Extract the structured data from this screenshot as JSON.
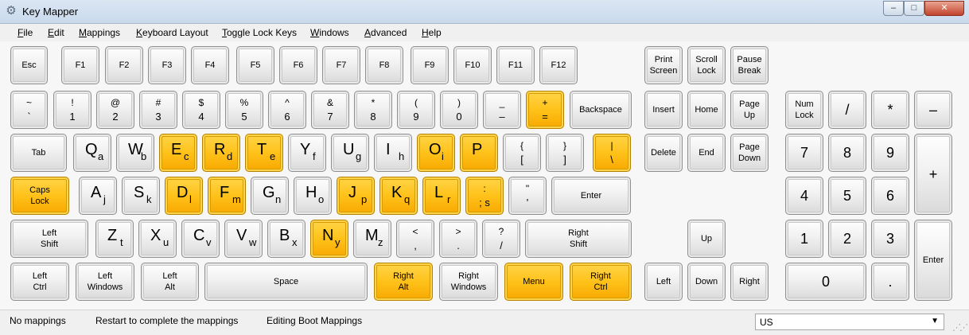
{
  "window": {
    "title": "Key Mapper",
    "minimize_glyph": "–",
    "maximize_glyph": "□",
    "close_glyph": "✕"
  },
  "menu": [
    "File",
    "Edit",
    "Mappings",
    "Keyboard Layout",
    "Toggle Lock Keys",
    "Windows",
    "Advanced",
    "Help"
  ],
  "keys": {
    "esc": "Esc",
    "f1": "F1",
    "f2": "F2",
    "f3": "F3",
    "f4": "F4",
    "f5": "F5",
    "f6": "F6",
    "f7": "F7",
    "f8": "F8",
    "f9": "F9",
    "f10": "F10",
    "f11": "F11",
    "f12": "F12",
    "print_screen": [
      "Print",
      "Screen"
    ],
    "scroll_lock": [
      "Scroll",
      "Lock"
    ],
    "pause_break": [
      "Pause",
      "Break"
    ],
    "backquote": [
      "~",
      "`"
    ],
    "digit1": [
      "!",
      "1"
    ],
    "digit2": [
      "@",
      "2"
    ],
    "digit3": [
      "#",
      "3"
    ],
    "digit4": [
      "$",
      "4"
    ],
    "digit5": [
      "%",
      "5"
    ],
    "digit6": [
      "^",
      "6"
    ],
    "digit7": [
      "&",
      "7"
    ],
    "digit8": [
      "*",
      "8"
    ],
    "digit9": [
      "(",
      "9"
    ],
    "digit0": [
      ")",
      "0"
    ],
    "minus": [
      "_",
      "–"
    ],
    "equal": [
      "+",
      "="
    ],
    "backspace": "Backspace",
    "insert": "Insert",
    "home": "Home",
    "page_up": [
      "Page",
      "Up"
    ],
    "num_lock": [
      "Num",
      "Lock"
    ],
    "num_divide": "/",
    "num_multiply": "*",
    "num_minus": "–",
    "tab": "Tab",
    "q": [
      "Q",
      "a"
    ],
    "w": [
      "W",
      "b"
    ],
    "e": [
      "E",
      "c"
    ],
    "r": [
      "R",
      "d"
    ],
    "t": [
      "T",
      "e"
    ],
    "y": [
      "Y",
      "f"
    ],
    "u": [
      "U",
      "g"
    ],
    "i": [
      "I",
      "h"
    ],
    "o": [
      "O",
      "i"
    ],
    "p": [
      "P",
      ""
    ],
    "bracket_left": [
      "{",
      "["
    ],
    "bracket_right": [
      "}",
      "]"
    ],
    "backslash": [
      "|",
      "\\"
    ],
    "delete": "Delete",
    "end": "End",
    "page_down": [
      "Page",
      "Down"
    ],
    "num7": "7",
    "num8": "8",
    "num9": "9",
    "num_plus": "+",
    "caps_lock": [
      "Caps",
      "Lock"
    ],
    "a": [
      "A",
      "j"
    ],
    "s": [
      "S",
      "k"
    ],
    "d": [
      "D",
      "l"
    ],
    "f": [
      "F",
      "m"
    ],
    "g": [
      "G",
      "n"
    ],
    "h": [
      "H",
      "o"
    ],
    "j": [
      "J",
      "p"
    ],
    "k": [
      "K",
      "q"
    ],
    "l": [
      "L",
      "r"
    ],
    "semicolon": [
      ":",
      "; s"
    ],
    "quote": [
      "\"",
      "'"
    ],
    "enter": "Enter",
    "num4": "4",
    "num5": "5",
    "num6": "6",
    "left_shift": [
      "Left",
      "Shift"
    ],
    "z": [
      "Z",
      "t"
    ],
    "x": [
      "X",
      "u"
    ],
    "c": [
      "C",
      "v"
    ],
    "v": [
      "V",
      "w"
    ],
    "b": [
      "B",
      "x"
    ],
    "n": [
      "N",
      "y"
    ],
    "m": [
      "M",
      "z"
    ],
    "comma": [
      "<",
      ","
    ],
    "period": [
      ">",
      "."
    ],
    "slash": [
      "?",
      "/"
    ],
    "right_shift": [
      "Right",
      "Shift"
    ],
    "up": "Up",
    "num1": "1",
    "num2": "2",
    "num3": "3",
    "num_enter": "Enter",
    "left_ctrl": [
      "Left",
      "Ctrl"
    ],
    "left_windows": [
      "Left",
      "Windows"
    ],
    "left_alt": [
      "Left",
      "Alt"
    ],
    "space": "Space",
    "right_alt": [
      "Right",
      "Alt"
    ],
    "right_windows": [
      "Right",
      "Windows"
    ],
    "menu_key": "Menu",
    "right_ctrl": [
      "Right",
      "Ctrl"
    ],
    "left": "Left",
    "down": "Down",
    "right": "Right",
    "num0": "0",
    "num_decimal": "."
  },
  "mapped_keys": [
    "equal",
    "e",
    "r",
    "t",
    "o",
    "p",
    "backslash",
    "caps_lock",
    "d",
    "f",
    "j",
    "k",
    "l",
    "semicolon",
    "n",
    "right_alt",
    "menu_key",
    "right_ctrl"
  ],
  "status": {
    "mappings": "No mappings",
    "restart": "Restart to complete the mappings",
    "mode": "Editing Boot Mappings",
    "layout": "US"
  },
  "colors": {
    "mapped": "#ffc21a",
    "unmapped": "#e9e9e9"
  }
}
